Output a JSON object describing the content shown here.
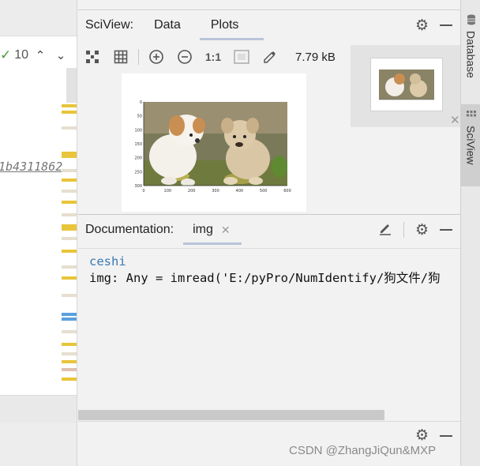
{
  "editor": {
    "inspection_count": "10",
    "hash_text": "1b4311862"
  },
  "sciview": {
    "title": "SciView:",
    "tabs": [
      {
        "label": "Data",
        "active": false
      },
      {
        "label": "Plots",
        "active": true
      }
    ],
    "toolbar": {
      "icons": [
        "fit-icon",
        "grid-icon",
        "zoom-in-icon",
        "zoom-out-icon",
        "actual-size-icon",
        "fit-window-icon",
        "color-picker-icon"
      ],
      "actual_size_label": "1:1",
      "image_size": "7.79 kB"
    },
    "plot": {
      "x_ticks": [
        "0",
        "100",
        "200",
        "300",
        "400",
        "500",
        "600"
      ],
      "y_ticks": [
        "0",
        "50",
        "100",
        "150",
        "200",
        "250",
        "300"
      ]
    }
  },
  "right_strip": {
    "database_label": "Database",
    "sciview_label": "SciView"
  },
  "documentation": {
    "title": "Documentation:",
    "tab_label": "img",
    "name_line": "ceshi",
    "signature_line": "img: Any = imread('E:/pyPro/NumIdentify/狗文件/狗"
  },
  "watermark": "CSDN @ZhangJiQun&MXP",
  "colors": {
    "accent_blue": "#3a78b4",
    "tab_underline": "#b8c4d8",
    "check_green": "#4a9a3a"
  }
}
